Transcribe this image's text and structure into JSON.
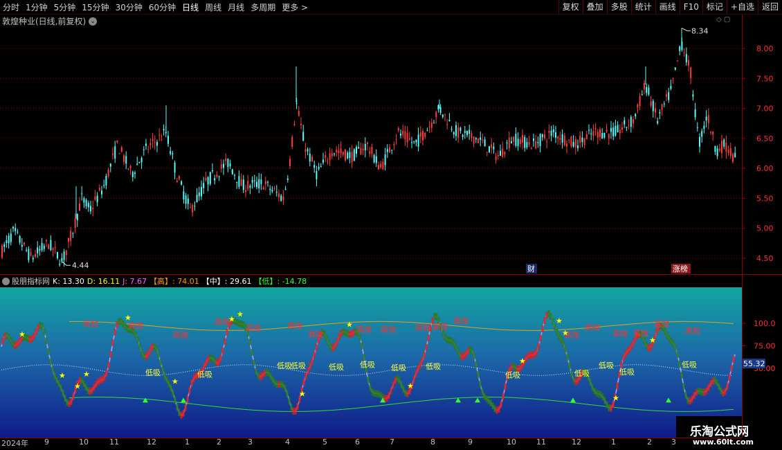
{
  "toolbar": {
    "periods": [
      "分时",
      "1分钟",
      "5分钟",
      "15分钟",
      "30分钟",
      "60分钟",
      "日线",
      "周线",
      "月线",
      "多周期",
      "更多 >"
    ],
    "active_period": "日线",
    "buttons": [
      "复权",
      "叠加",
      "多股",
      "统计",
      "画线",
      "F10",
      "标记",
      "+自选",
      "返回"
    ]
  },
  "main_chart": {
    "title": "敦煌种业(日线,前复权)",
    "price_ticks": [
      "8.00",
      "7.50",
      "7.00",
      "6.50",
      "6.00",
      "5.50",
      "5.00",
      "4.50"
    ],
    "high_label": "8.34",
    "low_label": "4.44",
    "badges": [
      "财",
      "涨榜"
    ]
  },
  "indicator": {
    "name": "股朋指标网",
    "k_label": "K: 13.30",
    "d_label": "D: 16.11",
    "j_label": "J: 7.67",
    "high_label": "【高】: 74.01",
    "mid_label": "【中】: 29.61",
    "low_label": "【低】: -14.78",
    "axis_ticks": [
      "100.0",
      "75.00",
      "50.00"
    ],
    "current_value": "55.32",
    "labels": {
      "high_throw": "高抛",
      "low_buy": "低吸"
    }
  },
  "x_axis": [
    "2024年",
    "9",
    "10",
    "11",
    "12",
    "1",
    "2",
    "3",
    "4",
    "5",
    "6",
    "7",
    "8",
    "9",
    "10",
    "11",
    "12",
    "1",
    "2",
    "3"
  ],
  "watermark": {
    "title": "乐淘公式网",
    "url": "www.60lt.com"
  },
  "colors": {
    "up": "#ff3c3c",
    "down": "#54ffff",
    "grid": "#8b0000",
    "k_line": "#9a9cff",
    "yellow": "#ffff00"
  }
}
